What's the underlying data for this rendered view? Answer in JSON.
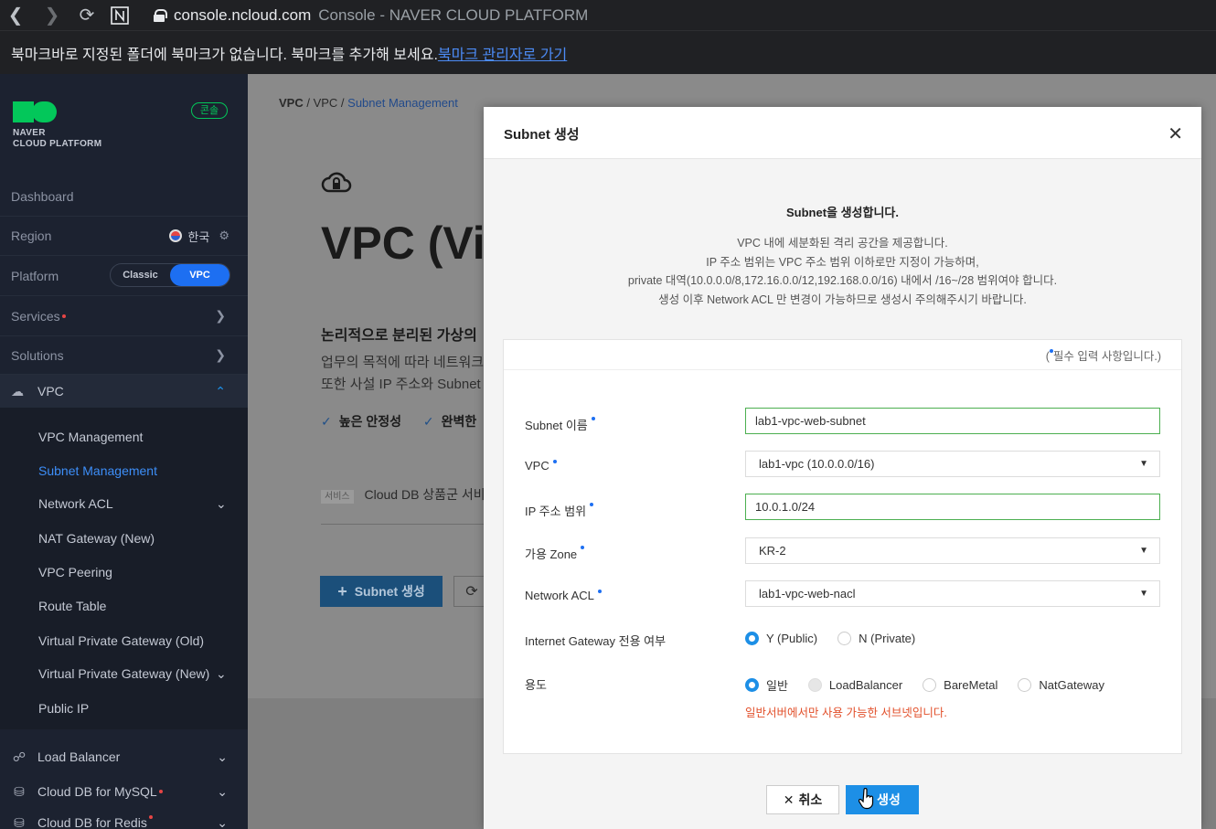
{
  "browser": {
    "host": "console.ncloud.com",
    "title": "Console - NAVER CLOUD PLATFORM",
    "bookmark_msg": "북마크바로 지정된 폴더에 북마크가 없습니다. 북마크를 추가해 보세요.",
    "bookmark_link": "북마크 관리자로 가기"
  },
  "sidebar": {
    "logo_line1": "NAVER",
    "logo_line2": "CLOUD PLATFORM",
    "console_badge": "콘솔",
    "dashboard": "Dashboard",
    "region": "Region",
    "region_value": "한국",
    "platform": "Platform",
    "platform_classic": "Classic",
    "platform_vpc": "VPC",
    "services": "Services",
    "solutions": "Solutions",
    "vpc": "VPC",
    "vpc_items": [
      "VPC Management",
      "Subnet Management",
      "Network ACL",
      "NAT Gateway (New)",
      "VPC Peering",
      "Route Table",
      "Virtual Private Gateway (Old)",
      "Virtual Private Gateway (New)",
      "Public IP"
    ],
    "bottom_items": [
      "Load Balancer",
      "Cloud DB for MySQL",
      "Cloud DB for Redis"
    ]
  },
  "main": {
    "breadcrumb": [
      "VPC",
      "VPC",
      "Subnet Management"
    ],
    "title": "VPC (Vi",
    "subtitle": "논리적으로 분리된 가상의",
    "desc1": "업무의 목적에 따라 네트워크를",
    "desc2": "또한 사설 IP 주소와 Subnet",
    "check1": "높은 안정성",
    "check2": "완벽한",
    "svc_tag": "서비스",
    "svc_text": "Cloud DB 상품군 서비스",
    "create_btn": "Subnet 생성"
  },
  "modal": {
    "title": "Subnet 생성",
    "intro_title": "Subnet을 생성합니다.",
    "intro_lines": [
      "VPC 내에 세분화된 격리 공간을 제공합니다.",
      "IP 주소 범위는 VPC 주소 범위 이하로만 지정이 가능하며,",
      "private 대역(10.0.0.0/8,172.16.0.0/12,192.168.0.0/16) 내에서 /16~/28 범위여야 합니다.",
      "생성 이후 Network ACL 만 변경이 가능하므로 생성시 주의해주시기 바랍니다."
    ],
    "required_note": "필수 입력 사항입니다.)",
    "fields": {
      "subnet_name_label": "Subnet 이름",
      "subnet_name_value": "lab1-vpc-web-subnet",
      "vpc_label": "VPC",
      "vpc_value": "lab1-vpc (10.0.0.0/16)",
      "ip_label": "IP 주소 범위",
      "ip_value": "10.0.1.0/24",
      "zone_label": "가용 Zone",
      "zone_value": "KR-2",
      "acl_label": "Network ACL",
      "acl_value": "lab1-vpc-web-nacl",
      "igw_label": "Internet Gateway 전용 여부",
      "igw_options": [
        "Y (Public)",
        "N (Private)"
      ],
      "usage_label": "용도",
      "usage_options": [
        "일반",
        "LoadBalancer",
        "BareMetal",
        "NatGateway"
      ]
    },
    "warning": "일반서버에서만 사용 가능한 서브넷입니다.",
    "cancel": "취소",
    "create": "생성"
  }
}
